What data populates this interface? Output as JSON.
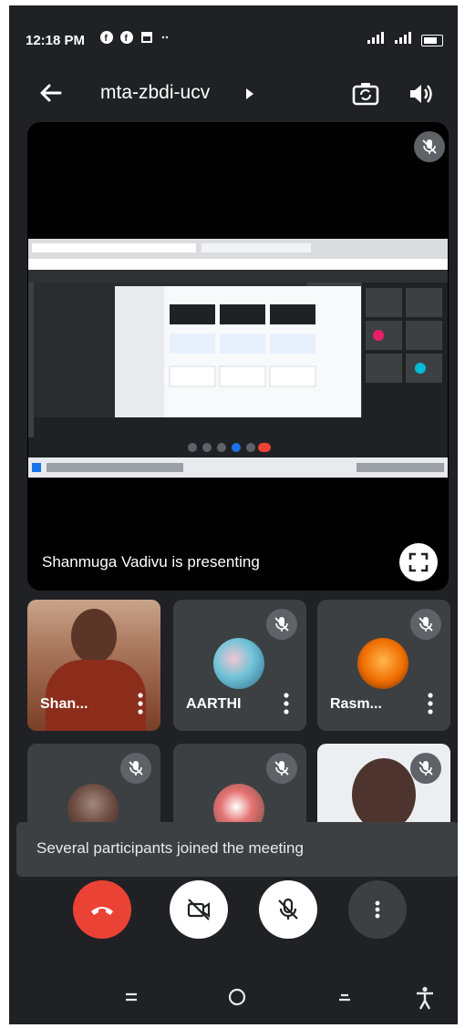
{
  "status_bar": {
    "time": "12:18 PM",
    "notification_icons": [
      "facebook-icon",
      "facebook-icon",
      "gallery-icon",
      "more-dots"
    ],
    "signal_text": "ᵥₒₗ"
  },
  "toolbar": {
    "meeting_code": "mta-zbdi-ucv",
    "icons": [
      "back-arrow-icon",
      "camera-switch-icon",
      "speaker-icon"
    ]
  },
  "presenter": {
    "label": "Shanmuga Vadivu is presenting"
  },
  "participants": [
    {
      "name": "Shan..."
    },
    {
      "name": "AARTHI"
    },
    {
      "name": "Rasm..."
    }
  ],
  "toast": {
    "message": "Several participants joined the meeting"
  },
  "controls": [
    "end-call",
    "camera-off",
    "mic-off",
    "more-options"
  ],
  "colors": {
    "background": "#202124",
    "tile": "#3c4043",
    "end_call": "#ea4335",
    "button_white": "#ffffff"
  }
}
